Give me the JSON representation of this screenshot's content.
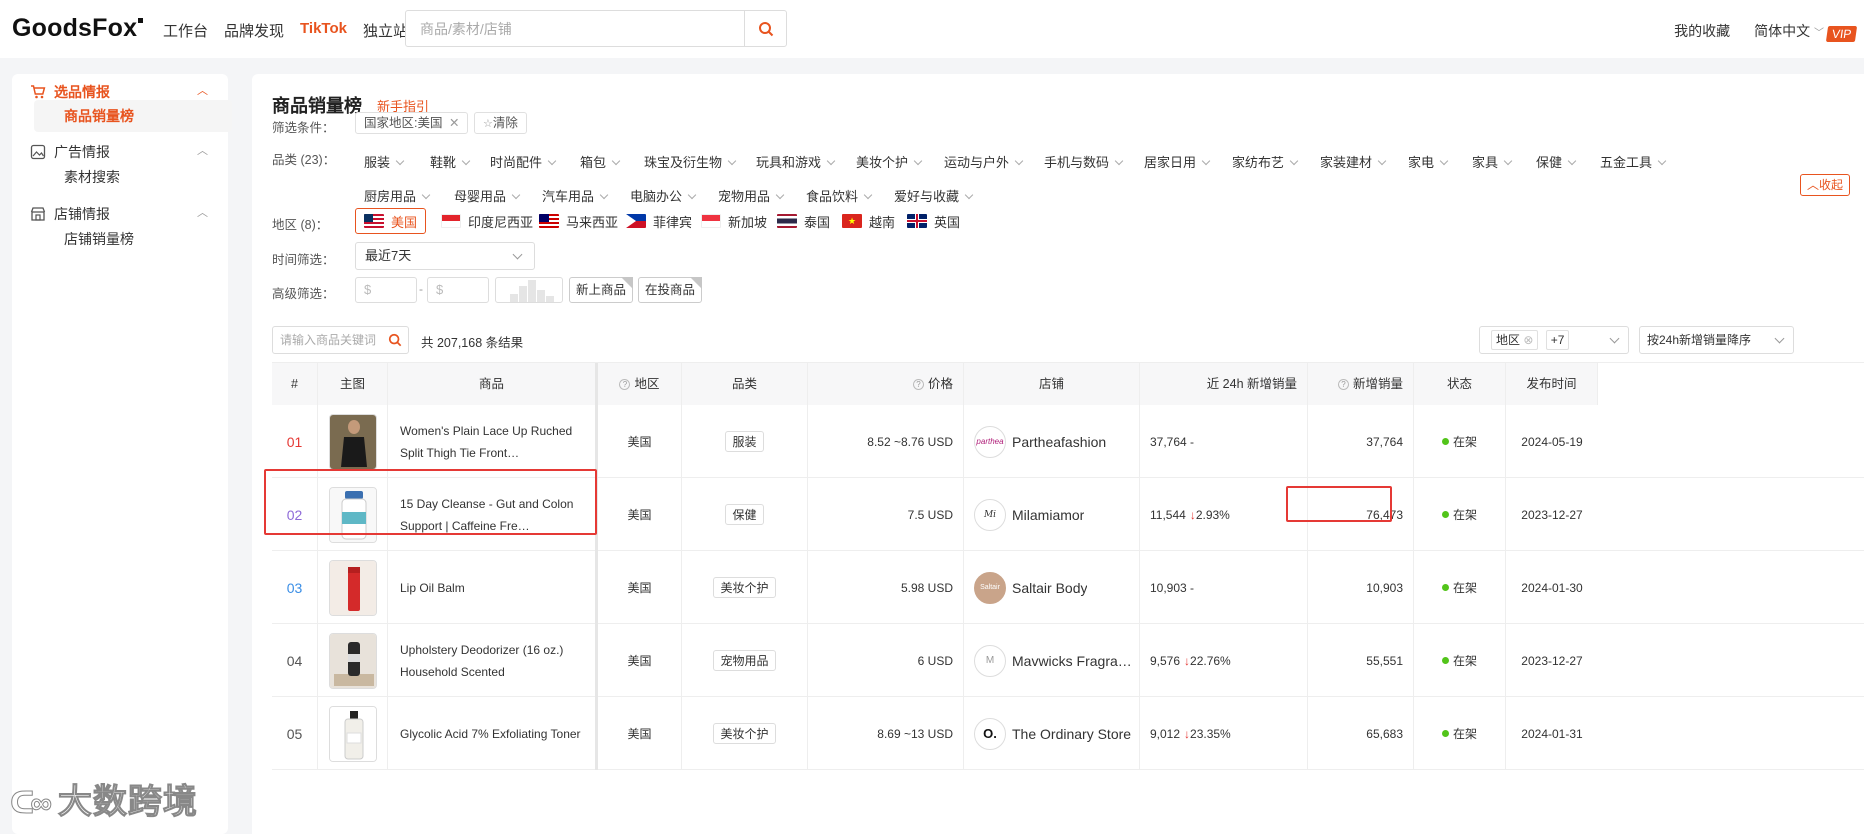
{
  "header": {
    "logo": "GoodsFox",
    "nav": [
      "工作台",
      "品牌发现",
      "TikTok",
      "独立站"
    ],
    "search_placeholder": "商品/素材/店铺",
    "favorites": "我的收藏",
    "language": "简体中文",
    "vip": "VIP"
  },
  "sidebar": {
    "groups": [
      {
        "label": "选品情报",
        "items": [
          "商品销量榜"
        ]
      },
      {
        "label": "广告情报",
        "items": [
          "素材搜索"
        ]
      },
      {
        "label": "店铺情报",
        "items": [
          "店铺销量榜"
        ]
      }
    ]
  },
  "page": {
    "title": "商品销量榜",
    "guide": "新手指引"
  },
  "filters": {
    "conditions_label": "筛选条件：",
    "active_tag": "国家地区:美国",
    "clear": "清除",
    "category_label": "品类 (23)：",
    "categories": [
      "服装",
      "鞋靴",
      "时尚配件",
      "箱包",
      "珠宝及衍生物",
      "玩具和游戏",
      "美妆个护",
      "运动与户外",
      "手机与数码",
      "居家日用",
      "家纺布艺",
      "家装建材",
      "家电",
      "家具",
      "保健",
      "五金工具",
      "厨房用品",
      "母婴用品",
      "汽车用品",
      "电脑办公",
      "宠物用品",
      "食品饮料",
      "爱好与收藏"
    ],
    "collapse": "收起",
    "region_label": "地区 (8)：",
    "regions": [
      "美国",
      "印度尼西亚",
      "马来西亚",
      "菲律宾",
      "新加坡",
      "泰国",
      "越南",
      "英国"
    ],
    "time_label": "时间筛选：",
    "time_value": "最近7天",
    "advanced_label": "高级筛选：",
    "currency": "$",
    "price_sep": "-",
    "new_products": "新上商品",
    "advertising": "在投商品"
  },
  "list": {
    "keyword_placeholder": "请输入商品关键词",
    "total": "共 207,168 条结果",
    "region_filter": "地区",
    "region_more": "+7",
    "sort": "按24h新增销量降序",
    "columns": [
      "#",
      "主图",
      "商品",
      "地区",
      "品类",
      "价格",
      "店铺",
      "近 24h 新增销量",
      "新增销量",
      "状态",
      "发布时间"
    ],
    "rows": [
      {
        "rank": "01",
        "name": "Women's Plain Lace Up Ruched Split Thigh Tie Front…",
        "region": "美国",
        "category": "服装",
        "price": "8.52 ~8.76 USD",
        "store": "Partheafashion",
        "store_logo": "parthea",
        "sales24h": "37,764",
        "change": "-",
        "sales": "37,764",
        "status": "在架",
        "date": "2024-05-19"
      },
      {
        "rank": "02",
        "name": "15 Day Cleanse - Gut and Colon Support | Caffeine Fre…",
        "region": "美国",
        "category": "保健",
        "price": "7.5 USD",
        "store": "Milamiamor",
        "store_logo": "Mi",
        "sales24h": "11,544",
        "change": "2.93%",
        "sales": "76,473",
        "status": "在架",
        "date": "2023-12-27"
      },
      {
        "rank": "03",
        "name": "Lip Oil Balm",
        "region": "美国",
        "category": "美妆个护",
        "price": "5.98 USD",
        "store": "Saltair Body",
        "store_logo": "Saltair",
        "sales24h": "10,903",
        "change": "-",
        "sales": "10,903",
        "status": "在架",
        "date": "2024-01-30"
      },
      {
        "rank": "04",
        "name": "Upholstery Deodorizer (16 oz.) Household Scented",
        "region": "美国",
        "category": "宠物用品",
        "price": "6 USD",
        "store": "Mavwicks Fragrance…",
        "store_logo": "M",
        "sales24h": "9,576",
        "change": "22.76%",
        "sales": "55,551",
        "status": "在架",
        "date": "2023-12-27"
      },
      {
        "rank": "05",
        "name": "Glycolic Acid 7% Exfoliating Toner",
        "region": "美国",
        "category": "美妆个护",
        "price": "8.69 ~13 USD",
        "store": "The Ordinary Store",
        "store_logo": "O.",
        "sales24h": "9,012",
        "change": "23.35%",
        "sales": "65,683",
        "status": "在架",
        "date": "2024-01-31"
      }
    ]
  },
  "watermark": "大数跨境",
  "colors": {
    "accent": "#e8541f",
    "rank1": "#e53935",
    "rank2": "#8e6ad8",
    "rank3": "#3a8ee6",
    "status": "#52c41a",
    "highlight": "#e53935"
  }
}
